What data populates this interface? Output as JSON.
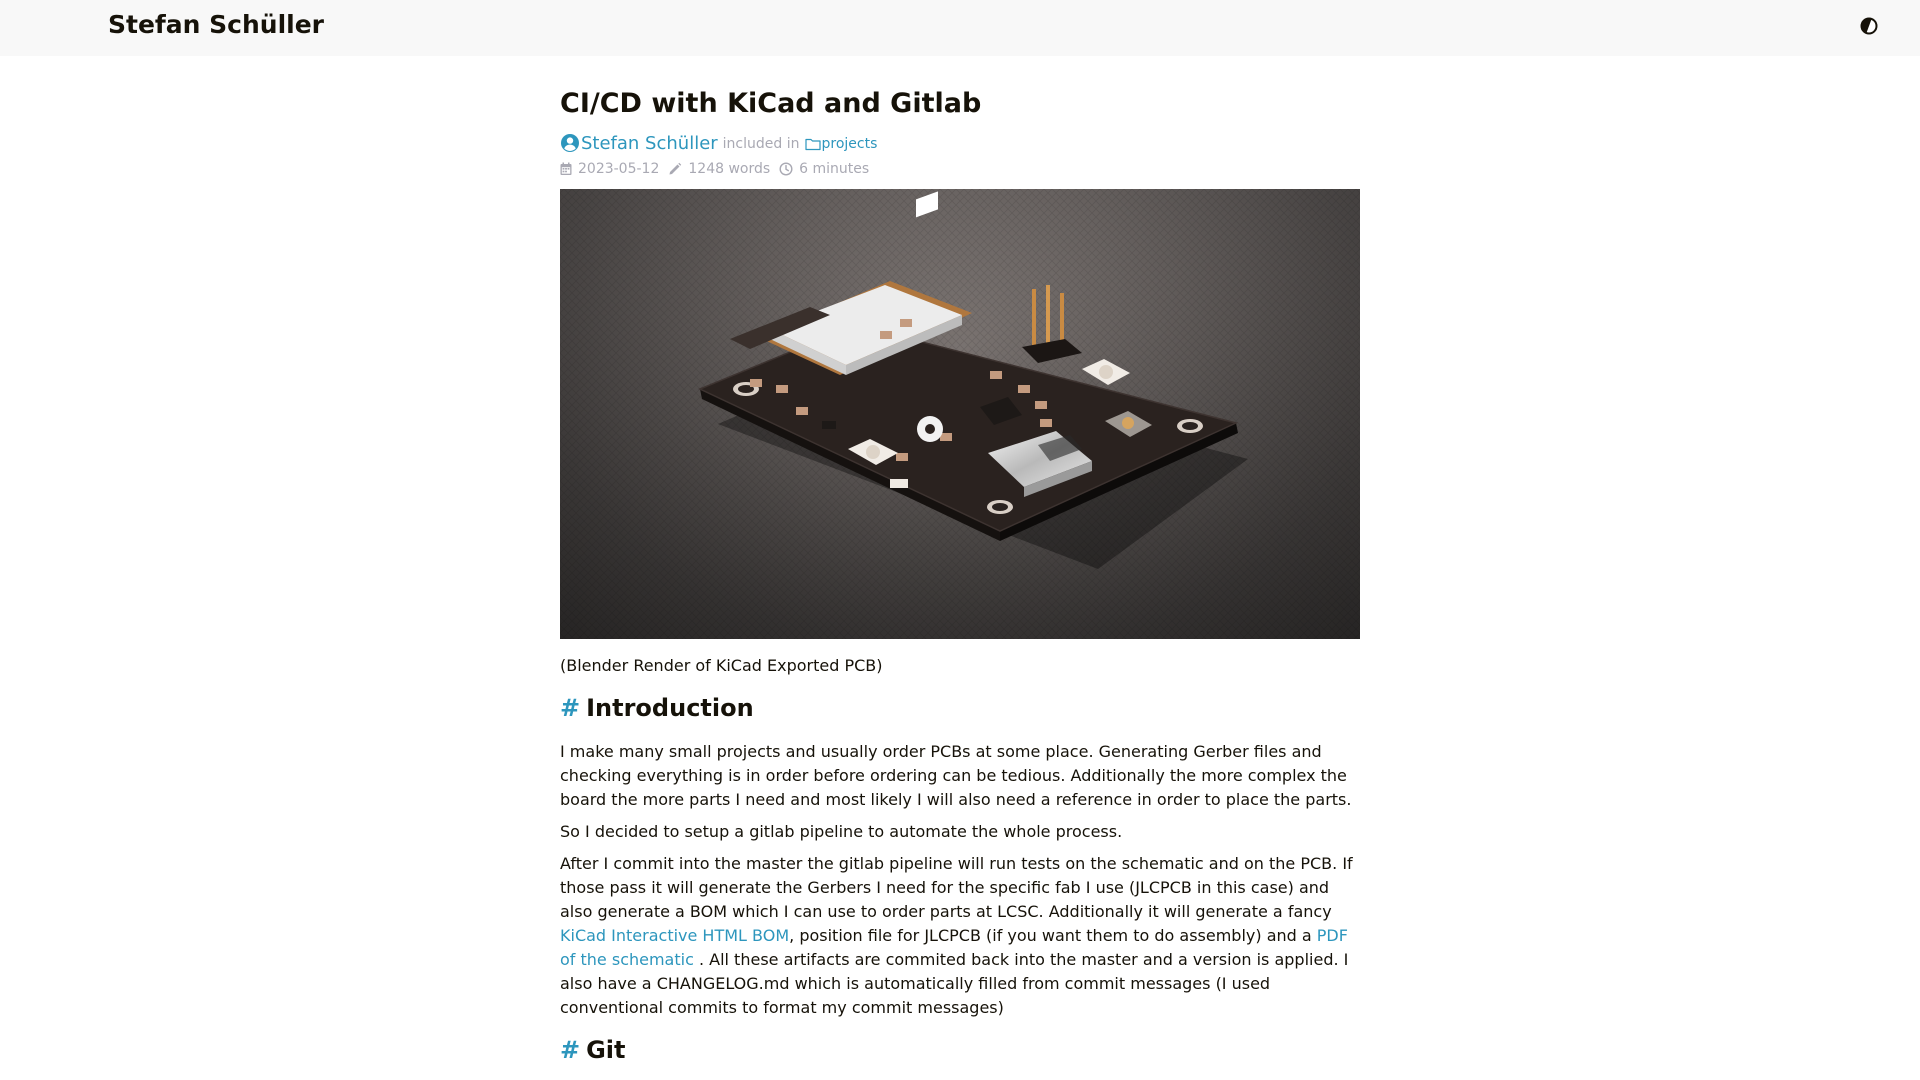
{
  "header": {
    "site_title": "Stefan Schüller",
    "theme_toggle_icon": "contrast-icon"
  },
  "post": {
    "title": "CI/CD with KiCad and Gitlab",
    "author": "Stefan Schüller",
    "included_in": "included in",
    "category": "projects",
    "date": "2023-05-12",
    "words": "1248 words",
    "reading_time": "6 minutes",
    "image_description": "Blender render of an ESP32 development PCB",
    "caption": "(Blender Render of KiCad Exported PCB)"
  },
  "sections": {
    "intro_heading": "Introduction",
    "intro_p1": "I make many small projects and usually order PCBs at some place. Generating Gerber files and checking everything is in order before ordering can be tedious. Additionally the more complex the board the more parts I need and most likely I will also need a reference in order to place the parts.",
    "intro_p2": "So I decided to setup a gitlab pipeline to automate the whole process.",
    "intro_p3_a": "After I commit into the master the gitlab pipeline will run tests on the schematic and on the PCB. If those pass it will generate the Gerbers I need for the specific fab I use (JLCPCB in this case) and also generate a BOM which I can use to order parts at LCSC. Additionally it will generate a fancy ",
    "intro_p3_link1": "KiCad Interactive HTML BOM",
    "intro_p3_b": ", position file for JLCPCB (if you want them to do assembly) and a ",
    "intro_p3_link2": "PDF of the schematic",
    "intro_p3_c": " . All these artifacts are commited back into the master and a version is applied. I also have a CHANGELOG.md which is automatically filled from commit messages (I used conventional commits to format my commit messages)",
    "git_heading": "Git"
  },
  "colors": {
    "accent": "#2d96bd",
    "text": "#161209",
    "muted": "#a9a9b3",
    "header_bg": "#f8f8f8"
  }
}
